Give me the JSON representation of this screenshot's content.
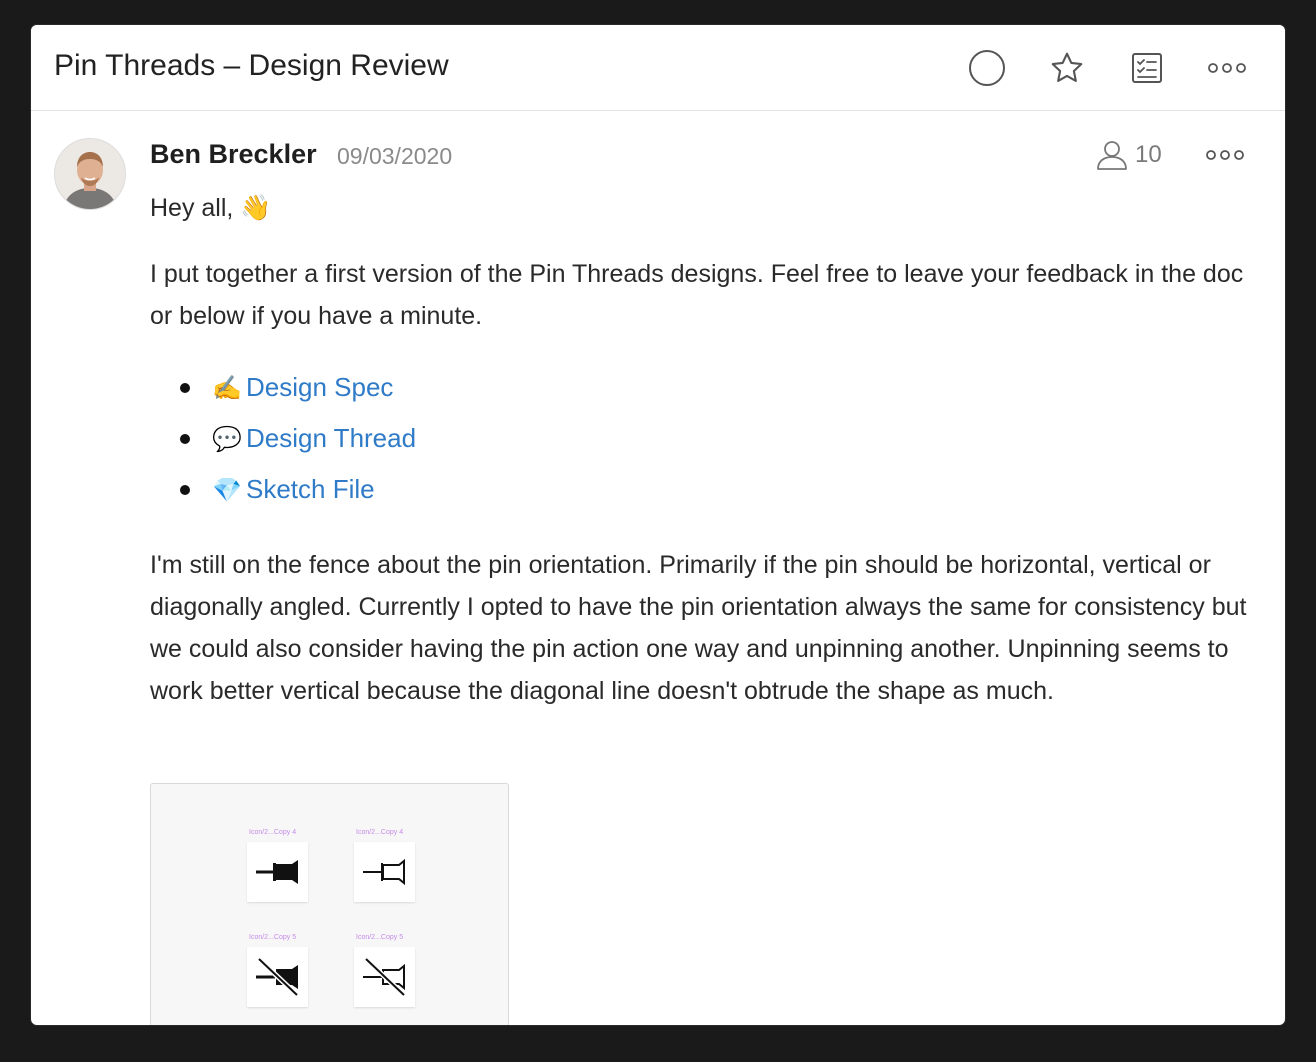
{
  "window": {
    "title": "Pin Threads – Design Review",
    "toolbar": {
      "circle_icon": "circle-icon",
      "star_icon": "star-icon",
      "checklist_icon": "checklist-icon",
      "more_icon": "more-icon"
    }
  },
  "message": {
    "author": "Ben Breckler",
    "date": "09/03/2020",
    "participants_count": "10",
    "greeting": "Hey all, 👋",
    "paragraph1": "I put together a first version of the Pin Threads designs. Feel free to leave your feedback in the doc or below if you have a minute.",
    "links": [
      {
        "emoji": "✍️",
        "label": "Design Spec"
      },
      {
        "emoji": "💬",
        "label": "Design Thread"
      },
      {
        "emoji": "💎",
        "label": "Sketch File"
      }
    ],
    "paragraph2": "I'm still on the fence about the pin orientation. Primarily if the pin should be horizontal, vertical or diagonally angled. Currently I opted to have the pin orientation always the same for consistency but we could also consider having the pin action one way and unpinning another. Unpinning seems to work better vertical because the diagonal line doesn't obtrude the shape as much.",
    "attachment": {
      "labels": [
        "Icon/2...Copy 4",
        "Icon/2...Copy 4",
        "Icon/2...Copy 5",
        "Icon/2...Copy 5"
      ]
    }
  },
  "colors": {
    "link": "#2f7bc8",
    "text": "#2a2a2a",
    "muted": "#8a8a8a",
    "label_pink": "#c58be8"
  }
}
